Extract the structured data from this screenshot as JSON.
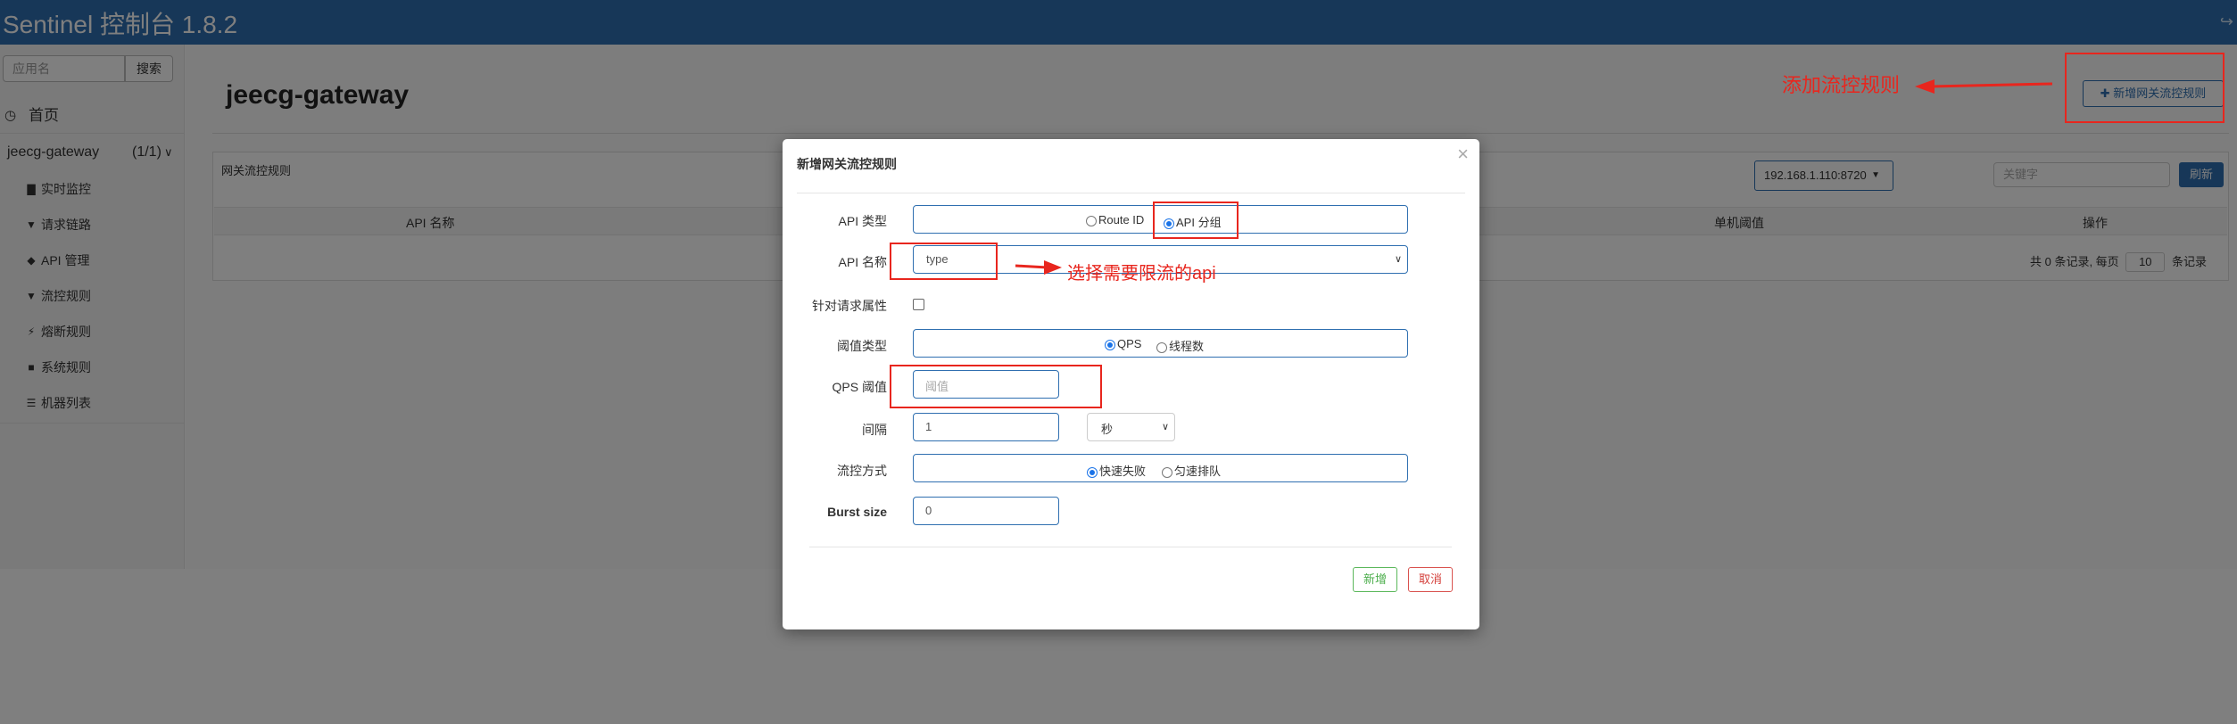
{
  "header": {
    "title": "Sentinel 控制台 1.8.2",
    "logout_icon": "sign-out-icon"
  },
  "sidebar": {
    "search_placeholder": "应用名",
    "search_button": "搜索",
    "home_label": "首页",
    "app": {
      "name": "jeecg-gateway",
      "count": "(1/1)"
    },
    "items": [
      {
        "label": "实时监控",
        "icon": "bar-chart-icon"
      },
      {
        "label": "请求链路",
        "icon": "filter-icon"
      },
      {
        "label": "API 管理",
        "icon": "tags-icon"
      },
      {
        "label": "流控规则",
        "icon": "filter-icon"
      },
      {
        "label": "熔断规则",
        "icon": "bolt-icon"
      },
      {
        "label": "系统规则",
        "icon": "lock-icon"
      },
      {
        "label": "机器列表",
        "icon": "list-icon"
      }
    ]
  },
  "main": {
    "title": "jeecg-gateway",
    "add_button": "新增网关流控规则",
    "panel_title": "网关流控规则",
    "machine": "192.168.1.110:8720",
    "keyword_placeholder": "关键字",
    "refresh_button": "刷新",
    "columns": [
      "API 名称",
      "单机阈值",
      "操作"
    ],
    "pager": {
      "prefix": "共 0 条记录, 每页",
      "page_size": "10",
      "suffix": "条记录"
    }
  },
  "modal": {
    "title": "新增网关流控规则",
    "fields": {
      "api_type": {
        "label": "API 类型",
        "options": [
          "Route ID",
          "API 分组"
        ],
        "selected": "API 分组"
      },
      "api_name": {
        "label": "API 名称",
        "value": "type"
      },
      "param_item": {
        "label": "针对请求属性",
        "checked": false
      },
      "grade": {
        "label": "阈值类型",
        "options": [
          "QPS",
          "线程数"
        ],
        "selected": "QPS"
      },
      "count": {
        "label": "QPS 阈值",
        "placeholder": "阈值"
      },
      "interval": {
        "label": "间隔",
        "value": "1",
        "unit": "秒"
      },
      "control_behavior": {
        "label": "流控方式",
        "options": [
          "快速失败",
          "匀速排队"
        ],
        "selected": "快速失败"
      },
      "burst": {
        "label": "Burst size",
        "value": "0"
      }
    },
    "save_button": "新增",
    "cancel_button": "取消"
  },
  "annotations": {
    "add_rule": "添加流控规则",
    "select_api": "选择需要限流的api",
    "color": "#e8261e"
  },
  "colors": {
    "brand": "#2f6fb0",
    "save": "#5cb85c",
    "cancel": "#d9534f"
  }
}
